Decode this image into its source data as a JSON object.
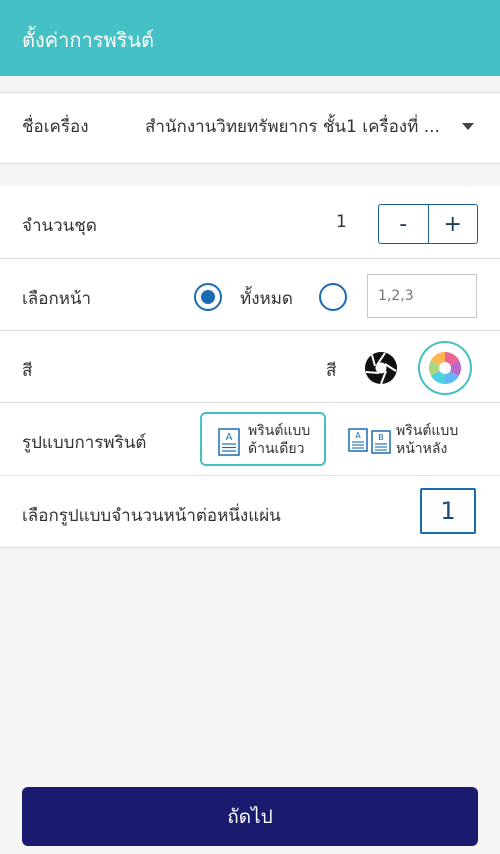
{
  "header": {
    "title": "ตั้งค่าการพรินต์"
  },
  "printer": {
    "label": "ชื่อเครื่อง",
    "selected": "สำนักงานวิทยทรัพยากร ชั้น1 เครื่องที่ ..."
  },
  "copies": {
    "label": "จำนวนชุด",
    "value": "1",
    "minus_label": "-",
    "plus_label": "+"
  },
  "pages": {
    "label": "เลือกหน้า",
    "all_label": "ทั้งหมด",
    "all_selected": true,
    "range_placeholder": "1,2,3"
  },
  "color": {
    "label": "สี",
    "option_label": "สี",
    "selected": "color",
    "accent": "#45c0c4"
  },
  "print_mode": {
    "label": "รูปแบบการพรินต์",
    "single_label": "พรินต์แบบ\nด้านเดียว",
    "double_label": "พรินต์แบบ\nหน้าหลัง",
    "selected": "single"
  },
  "pages_per_sheet": {
    "label": "เลือกรูปแบบจำนวนหน้าต่อหนึ่งแผ่น",
    "value": "1"
  },
  "actions": {
    "next_label": "ถัดไป"
  },
  "theme": {
    "header_color": "#45c0c4",
    "button_color": "#1a1a6f",
    "radio_color": "#1b6bb3"
  }
}
